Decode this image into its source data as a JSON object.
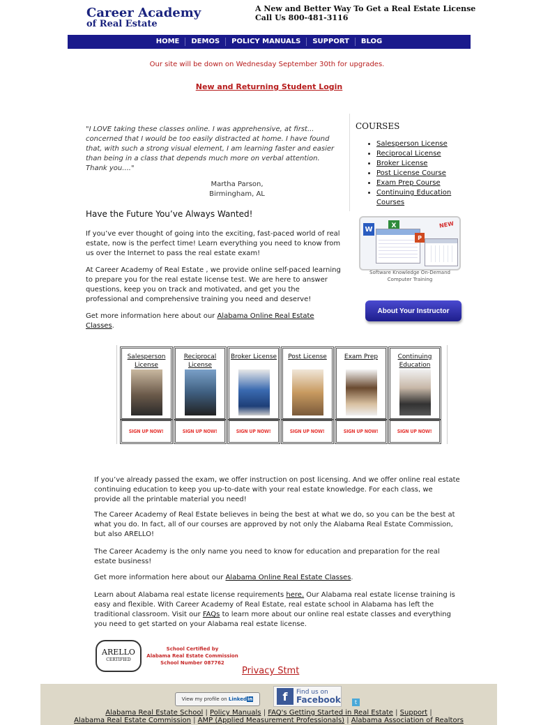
{
  "header": {
    "logo_line1": "Career Academy",
    "logo_line2": "of Real Estate",
    "tagline": "A New and Better Way To Get a Real Estate License",
    "phone": "Call Us 800-481-3116"
  },
  "nav": [
    "HOME",
    "DEMOS",
    "POLICY MANUALS",
    "SUPPORT",
    "BLOG"
  ],
  "notice": "Our site will be down on Wednesday September 30th for upgrades.",
  "login_link": "New and Returning Student Login",
  "testimonial": {
    "quote": "\"I LOVE taking these classes online. I was apprehensive, at first... concerned that I would be too easily distracted at home. I have found that, with such a strong visual element, I am learning faster and easier than being in a class that depends much more on verbal attention. Thank you....\"",
    "name": "Martha Parson,",
    "city": "Birmingham, AL"
  },
  "intro": {
    "heading": "Have the Future You’ve Always Wanted!",
    "p1": "If you’ve ever thought of going into the exciting, fast-paced world of real estate, now is the perfect time! Learn everything you need to know from us over the Internet to pass the real estate exam!",
    "p2": "At Career Academy of Real Estate , we provide online self-paced learning to prepare you for the real estate license test. We are here to answer questions, keep you on track and motivated, and get you the professional and comprehensive training you need and deserve!",
    "p3_prefix": "Get more information here about our ",
    "p3_link": "Alabama Online Real Estate Classes",
    "p3_suffix": "."
  },
  "sidebar": {
    "courses_title": "COURSES",
    "courses": [
      "Salesperson License",
      "Reciprocal License",
      "Broker License",
      "Post License Course",
      "Exam Prep Course",
      "Continuing Education Courses"
    ],
    "software_caption": "Software Knowledge On-Demand Computer Training",
    "new_badge": "NEW",
    "instructor_button": "About Your Instructor"
  },
  "cards": [
    {
      "label": "Salesperson License",
      "signup": "SIGN UP NOW!"
    },
    {
      "label": "Reciprocal License",
      "signup": "SIGN UP NOW!"
    },
    {
      "label": "Broker License",
      "signup": "SIGN UP NOW!"
    },
    {
      "label": "Post License",
      "signup": "SIGN UP NOW!"
    },
    {
      "label": "Exam Prep",
      "signup": "SIGN UP NOW!"
    },
    {
      "label": "Continuing Education",
      "signup": "SIGN UP NOW!"
    }
  ],
  "body": {
    "p1": "If you’ve already passed the exam, we offer instruction on post licensing. And we offer online real estate continuing education to keep you up-to-date with your real estate knowledge. For each class, we provide all the printable material you need!",
    "p2": "The Career Academy of Real Estate believes in being the best at what we do, so you can be the best at what you do. In fact, all of our courses are approved by not only the Alabama Real Estate Commission, but also ARELLO!",
    "p3": "The Career Academy is the only name you need to know for education and preparation for the real estate business!",
    "p4_prefix": "Get more information here about our ",
    "p4_link": "Alabama Online Real Estate Classes",
    "p4_suffix": ".",
    "p5_a": "Learn about Alabama real estate license requirements ",
    "p5_link1": "here.",
    "p5_b": " Our Alabama real estate license training is easy and flexible. With Career Academy of Real Estate, real estate school in Alabama has left the traditional classroom. Visit our ",
    "p5_link2": "FAQs",
    "p5_c": " to learn more about our online real estate classes and everything you need to get started on your Alabama real estate license."
  },
  "certification": {
    "seal": "ARELLO",
    "seal_sub": "CERTIFIED",
    "line1": "School Certified by",
    "line2": "Alabama Real Estate Commission",
    "line3": "School Number 087762"
  },
  "privacy": "Privacy Stmt",
  "footer": {
    "linkedin_text": "View my profile on",
    "linkedin_brand": "Linked",
    "linkedin_in": "in",
    "facebook_top": "Find us on",
    "facebook_brand": "Facebook",
    "links_row1": [
      "Alabama Real Estate School",
      "Policy Manuals",
      "FAQ's Getting Started in Real Estate",
      "Support"
    ],
    "links_row2": [
      "Alabama Real Estate Commission",
      "AMP (Applied Measurement Professionals)",
      "Alabama Association of Realtors"
    ]
  },
  "colors": {
    "brand_navy": "#1a237e",
    "nav_bg": "#1a1a8c",
    "alert_red": "#b71c1c",
    "footer_bg": "#ddd8c8"
  }
}
